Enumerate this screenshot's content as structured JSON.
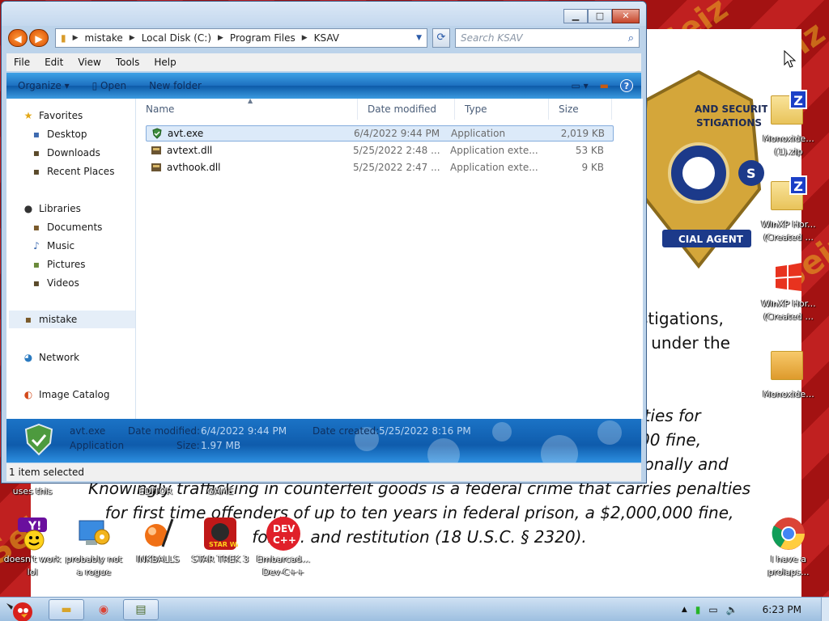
{
  "explorer": {
    "breadcrumb": [
      "mistake",
      "Local Disk (C:)",
      "Program Files",
      "KSAV"
    ],
    "search_placeholder": "Search KSAV",
    "menu": [
      "File",
      "Edit",
      "View",
      "Tools",
      "Help"
    ],
    "toolbar": {
      "organize": "Organize",
      "open": "Open",
      "new_folder": "New folder"
    },
    "nav": {
      "favorites": "Favorites",
      "desktop": "Desktop",
      "downloads": "Downloads",
      "recent": "Recent Places",
      "libraries": "Libraries",
      "documents": "Documents",
      "music": "Music",
      "pictures": "Pictures",
      "videos": "Videos",
      "user": "mistake",
      "network": "Network",
      "catalog": "Image Catalog"
    },
    "columns": [
      "Name",
      "Date modified",
      "Type",
      "Size"
    ],
    "files": [
      {
        "name": "avt.exe",
        "modified": "6/4/2022 9:44 PM",
        "type": "Application",
        "size": "2,019 KB"
      },
      {
        "name": "avtext.dll",
        "modified": "5/25/2022 2:48 ...",
        "type": "Application exte...",
        "size": "53 KB"
      },
      {
        "name": "avthook.dll",
        "modified": "5/25/2022 2:47 ...",
        "type": "Application exte...",
        "size": "9 KB"
      }
    ],
    "details": {
      "name": "avt.exe",
      "kind": "Application",
      "modified_label": "Date modified:",
      "modified_value": "6/4/2022 9:44 PM",
      "size_label": "Size:",
      "size_value": "1.97 MB",
      "created_label": "Date created:",
      "created_value": "5/25/2022 8:16 PM"
    },
    "status": "1 item selected"
  },
  "background_doc": {
    "badge_text": [
      "AND SECURITY",
      "STIGATIONS",
      "S",
      "CIAL AGENT"
    ],
    "fragments": [
      "stigations,",
      "t under the",
      "lties for",
      "00 fine,",
      "ionally and"
    ],
    "para_line1": "Knowingly trafficking in counterfeit goods is a federal crime that carries penalties",
    "para_line2": "for first time offenders of up to ten years in federal prison, a $2,000,000 fine,",
    "para_line3": "forfe... and restitution (18 U.S.C. § 2320).",
    "overlay_labels": [
      "uses this",
      "EDITOR",
      "GAME"
    ],
    "watermark": "Seiz"
  },
  "desktop_icons": [
    {
      "label": "Monoxide... (1).zip"
    },
    {
      "label": "WinXP Hor... (Created ..."
    },
    {
      "label": "WinXP Hor... (Created ..."
    },
    {
      "label": "Monoxide..."
    },
    {
      "label": "doesn't work lol"
    },
    {
      "label": "probably not a rogue"
    },
    {
      "label": "INKBALLS"
    },
    {
      "label": "STAR TREK 3"
    },
    {
      "label": "Embarcad... Dev-C++"
    },
    {
      "label": "I have a prolaps..."
    }
  ],
  "taskbar": {
    "clock": "6:23 PM"
  },
  "colors": {
    "accent": "#1d6fbf",
    "selection": "#dceaf9",
    "desktop": "#b01818"
  }
}
